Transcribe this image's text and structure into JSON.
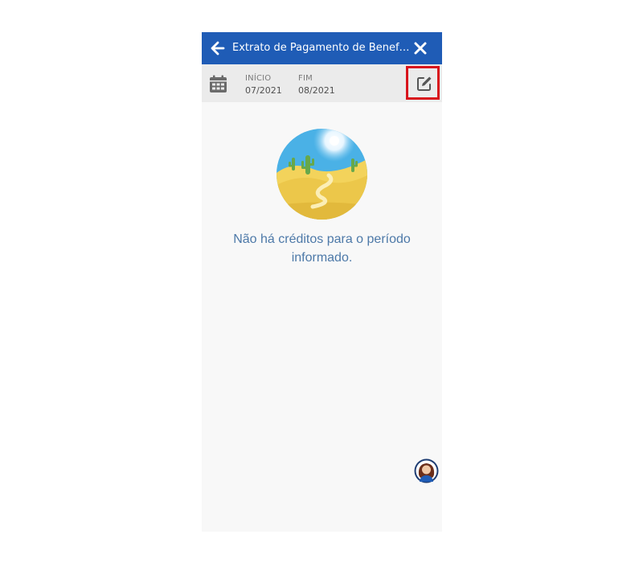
{
  "header": {
    "title": "Extrato de Pagamento de Benefício",
    "back_icon": "arrow-left-icon",
    "close_icon": "close-icon",
    "color": "#1f5cb6"
  },
  "period": {
    "icon": "calendar-icon",
    "start_label": "INÍCIO",
    "start_value": "07/2021",
    "end_label": "FIM",
    "end_value": "08/2021",
    "edit_icon": "edit-icon",
    "highlight_color": "#d8141c"
  },
  "empty_state": {
    "illustration": "desert-cactus-illustration",
    "message": "Não há créditos para o período informado."
  },
  "assistant": {
    "icon": "assistant-avatar"
  }
}
